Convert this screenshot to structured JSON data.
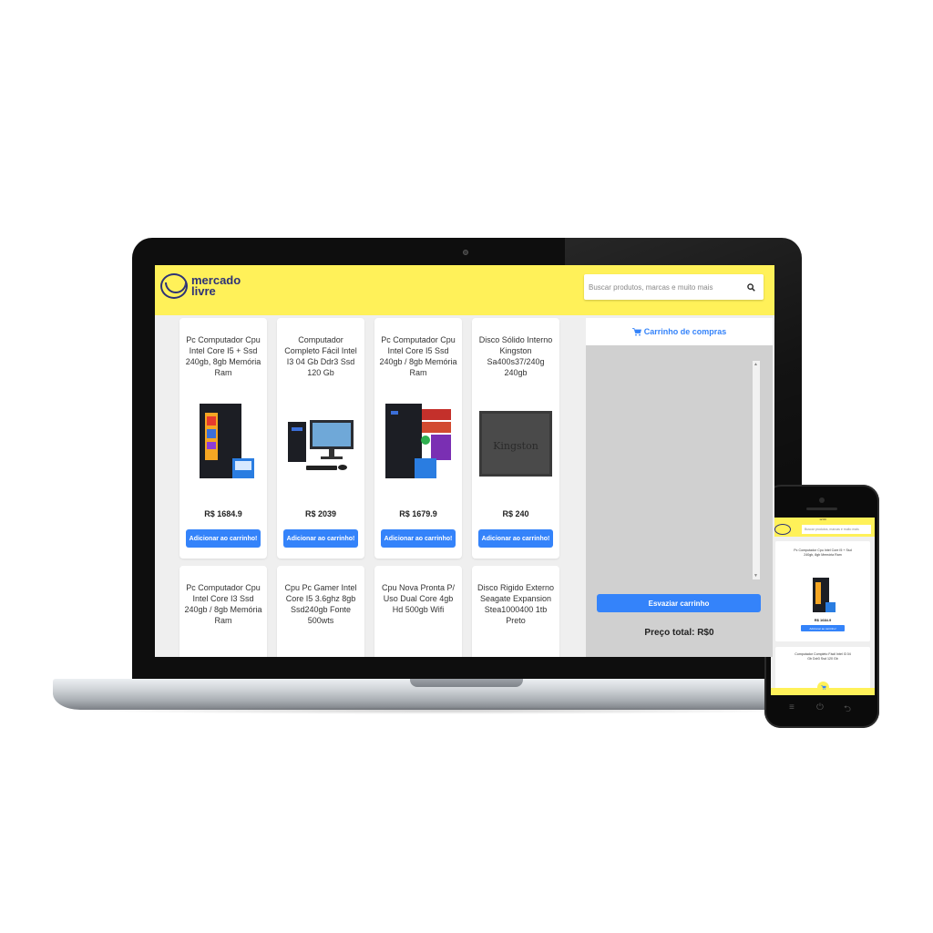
{
  "laptop_site": {
    "logo": {
      "line1": "mercado",
      "line2": "livre",
      "icon": "handshake-logo-icon"
    },
    "search": {
      "placeholder": "Buscar produtos, marcas e muito mais",
      "icon": "search-icon"
    },
    "products": [
      {
        "title": "Pc Computador Cpu Intel Core I5 + Ssd 240gb, 8gb Memória Ram",
        "price": "R$ 1684.9",
        "button": "Adicionar ao carrinho!",
        "image": "pc-tower-image"
      },
      {
        "title": "Computador Completo Fácil Intel I3 04 Gb Ddr3 Ssd 120 Gb",
        "price": "R$ 2039",
        "button": "Adicionar ao carrinho!",
        "image": "desktop-set-image"
      },
      {
        "title": "Pc Computador Cpu Intel Core I5 Ssd 240gb / 8gb Memória Ram",
        "price": "R$ 1679.9",
        "button": "Adicionar ao carrinho!",
        "image": "pc-tower-image"
      },
      {
        "title": "Disco Sólido Interno Kingston Sa400s37/240g 240gb",
        "price": "R$ 240",
        "button": "Adicionar ao carrinho!",
        "image": "ssd-image"
      },
      {
        "title": "Pc Computador Cpu Intel Core I3 Ssd 240gb / 8gb Memória Ram"
      },
      {
        "title": "Cpu Pc Gamer Intel Core I5 3.6ghz 8gb Ssd240gb Fonte 500wts"
      },
      {
        "title": "Cpu Nova Pronta P/ Uso Dual Core 4gb Hd 500gb Wifi"
      },
      {
        "title": "Disco Rigido Externo Seagate Expansion Stea1000400 1tb Preto"
      }
    ],
    "cart": {
      "title": "Carrinho de compras",
      "icon": "cart-icon",
      "empty_button": "Esvaziar carrinho",
      "total": "Preço total: R$0"
    },
    "ssd_brand": "Kingston"
  },
  "phone_site": {
    "status_time": "12:00",
    "search_placeholder": "Buscar produtos, marcas e muito mais",
    "products": [
      {
        "title": "Pc Computador Cpu Intel Core I5 + Ssd 240gb, 8gb Memória Ram",
        "price": "R$ 1684.9",
        "button": "Adicionar ao carrinho!"
      },
      {
        "title": "Computador Completo Fácil Intel I3 04 Gb Ddr3 Ssd 120 Gb"
      }
    ],
    "nav": {
      "menu": "≡",
      "home": "⏻",
      "back": "⮌"
    }
  },
  "colors": {
    "header_yellow": "#fff159",
    "accent_blue": "#3483fa",
    "brand_navy": "#2d3277"
  }
}
